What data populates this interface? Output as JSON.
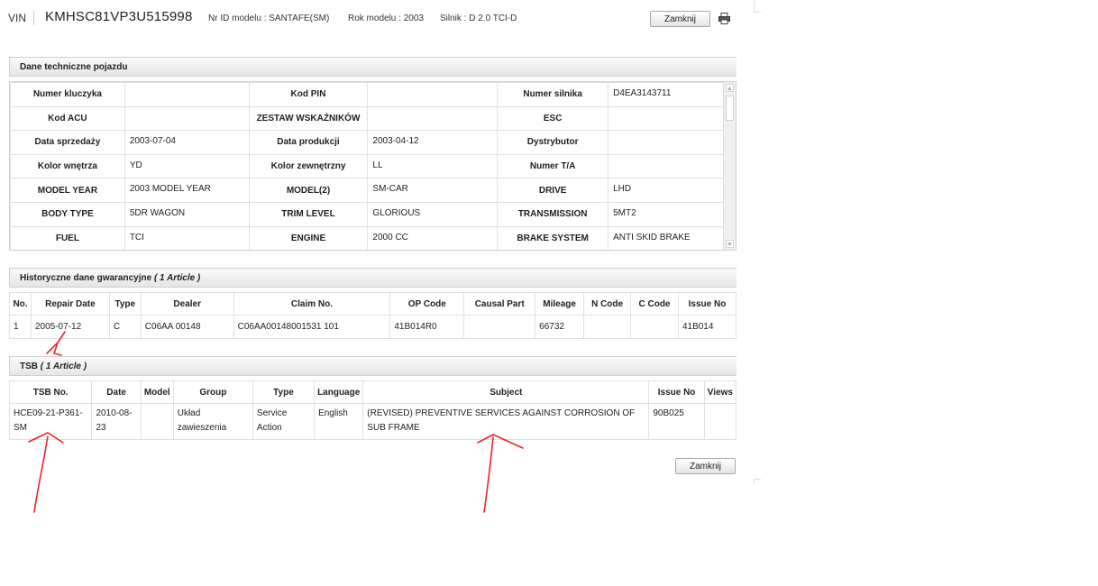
{
  "header": {
    "vin_label": "VIN",
    "vin_value": "KMHSC81VP3U515998",
    "model_id": "Nr ID modelu : SANTAFE(SM)",
    "model_year": "Rok modelu : 2003",
    "engine": "Silnik : D 2.0 TCI-D",
    "close_label": "Zamknij"
  },
  "tech": {
    "title": "Dane techniczne pojazdu",
    "rows": [
      [
        {
          "l": "Numer kluczyka",
          "v": ""
        },
        {
          "l": "Kod PIN",
          "v": ""
        },
        {
          "l": "Numer silnika",
          "v": "D4EA3143711"
        }
      ],
      [
        {
          "l": "Kod ACU",
          "v": ""
        },
        {
          "l": "ZESTAW WSKAŹNIKÓW",
          "v": ""
        },
        {
          "l": "ESC",
          "v": ""
        }
      ],
      [
        {
          "l": "Data sprzedaży",
          "v": "2003-07-04"
        },
        {
          "l": "Data produkcji",
          "v": "2003-04-12"
        },
        {
          "l": "Dystrybutor",
          "v": ""
        }
      ],
      [
        {
          "l": "Kolor wnętrza",
          "v": "YD"
        },
        {
          "l": "Kolor zewnętrzny",
          "v": "LL"
        },
        {
          "l": "Numer T/A",
          "v": ""
        }
      ],
      [
        {
          "l": "MODEL YEAR",
          "v": "2003 MODEL YEAR"
        },
        {
          "l": "MODEL(2)",
          "v": "SM-CAR"
        },
        {
          "l": "DRIVE",
          "v": "LHD"
        }
      ],
      [
        {
          "l": "BODY TYPE",
          "v": "5DR WAGON"
        },
        {
          "l": "TRIM LEVEL",
          "v": "GLORIOUS"
        },
        {
          "l": "TRANSMISSION",
          "v": "5MT2"
        }
      ],
      [
        {
          "l": "FUEL",
          "v": "TCI"
        },
        {
          "l": "ENGINE",
          "v": "2000 CC"
        },
        {
          "l": "BRAKE SYSTEM",
          "v": "ANTI SKID BRAKE"
        }
      ]
    ]
  },
  "warranty": {
    "title": "Historyczne dane gwarancyjne",
    "count": "( 1 Article )",
    "headers": [
      "No.",
      "Repair Date",
      "Type",
      "Dealer",
      "Claim No.",
      "OP Code",
      "Causal Part",
      "Mileage",
      "N Code",
      "C Code",
      "Issue No"
    ],
    "rows": [
      [
        "1",
        "2005-07-12",
        "C",
        "C06AA 00148",
        "C06AA00148001531 101",
        "41B014R0",
        "",
        "66732",
        "",
        "",
        "41B014"
      ]
    ]
  },
  "tsb": {
    "title": "TSB",
    "count": "( 1 Article )",
    "headers": [
      "TSB No.",
      "Date",
      "Model",
      "Group",
      "Type",
      "Language",
      "Subject",
      "Issue No",
      "Views"
    ],
    "rows": [
      [
        "HCE09-21-P361-SM",
        "2010-08-23",
        "",
        "Układ zawieszenia",
        "Service Action",
        "English",
        "(REVISED) PREVENTIVE SERVICES AGAINST CORROSION OF SUB FRAME",
        "90B025",
        ""
      ]
    ]
  },
  "footer": {
    "close_label": "Zamknij"
  },
  "icons": {
    "print": "printer-icon"
  },
  "colors": {
    "annotation": "#e8262a"
  }
}
